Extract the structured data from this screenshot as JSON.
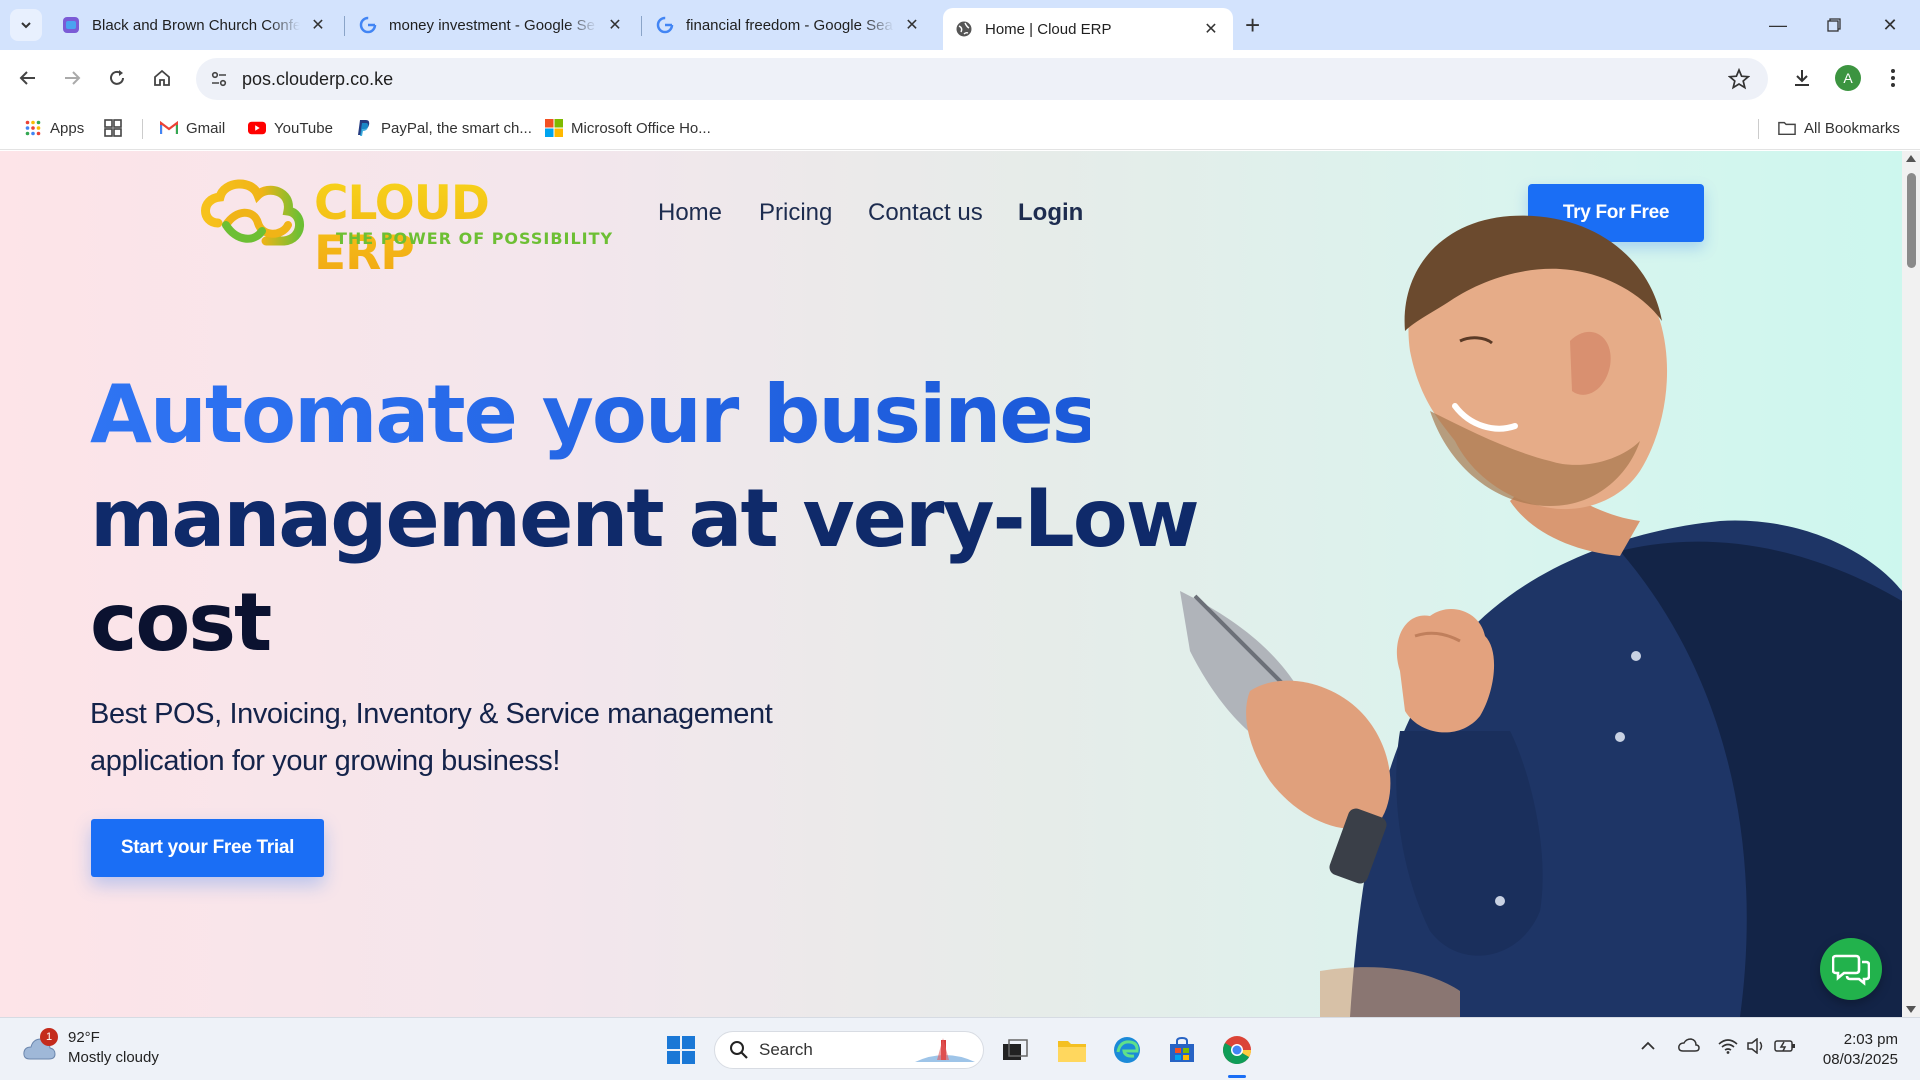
{
  "browser": {
    "tabs": [
      {
        "title": "Black and Brown Church Confer",
        "favicon": "canva-icon",
        "active": false
      },
      {
        "title": "money investment - Google Se",
        "favicon": "google-icon",
        "active": false
      },
      {
        "title": "financial freedom - Google Sea",
        "favicon": "google-icon",
        "active": false
      },
      {
        "title": "Home | Cloud ERP",
        "favicon": "globe-icon",
        "active": true
      }
    ],
    "url": "pos.clouderp.co.ke",
    "profile_initial": "A",
    "bookmarks": [
      {
        "label": "Apps",
        "icon": "apps-grid-icon"
      },
      {
        "label": "",
        "icon": "tab-groups-icon"
      },
      {
        "label": "Gmail",
        "icon": "gmail-icon"
      },
      {
        "label": "YouTube",
        "icon": "youtube-icon"
      },
      {
        "label": "PayPal, the smart ch...",
        "icon": "paypal-icon"
      },
      {
        "label": "Microsoft Office Ho...",
        "icon": "microsoft-icon"
      }
    ],
    "all_bookmarks_label": "All Bookmarks"
  },
  "site": {
    "logo": {
      "word": "CLOUD ERP",
      "tagline": "THE POWER OF POSSIBILITY"
    },
    "nav": [
      "Home",
      "Pricing",
      "Contact us",
      "Login"
    ],
    "cta_top": "Try For Free",
    "hero": {
      "title_line1": "Automate your business",
      "title_line2": "management at very-Low",
      "title_line3": "cost",
      "subtitle": "Best POS, Invoicing, Inventory & Service management application for your growing business!",
      "cta": "Start your Free Trial"
    },
    "colors": {
      "primary": "#1a6ef5",
      "logo_yellow": "#f2b318",
      "logo_green": "#6dbf34",
      "chat": "#22b24c"
    }
  },
  "taskbar": {
    "weather": {
      "temp": "92°F",
      "condition": "Mostly cloudy",
      "badge": "1"
    },
    "search_label": "Search",
    "clock": {
      "time": "2:03 pm",
      "date": "08/03/2025"
    }
  }
}
